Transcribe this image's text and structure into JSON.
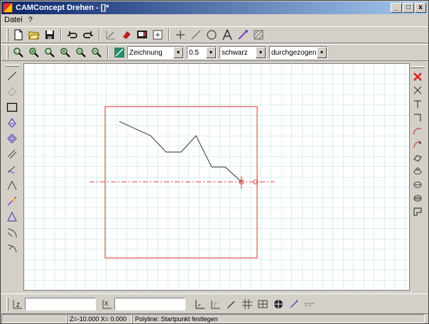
{
  "window": {
    "title": "CAMConcept Drehen - []*",
    "minimize": "_",
    "maximize": "□",
    "close": "x"
  },
  "menu": [
    {
      "label": "Datei"
    },
    {
      "label": "?"
    }
  ],
  "toolbar2": {
    "layer_select": "Zeichnung",
    "width_select": "0.5",
    "color_select": "schwarz",
    "linetype_select": "durchgezogen"
  },
  "bottom": {
    "x_label": "Z",
    "z_label": "X",
    "x_value": "",
    "z_value": ""
  },
  "status": {
    "empty": "",
    "coords": "Z=-10.000 X= 0.000",
    "message": "Polyline: Startpunkt festlegen"
  },
  "drawing": {
    "border_color": "#e05050",
    "grid_color": "#b8e0dc",
    "polyline_color": "#505050",
    "axis_color": "#e04040"
  }
}
